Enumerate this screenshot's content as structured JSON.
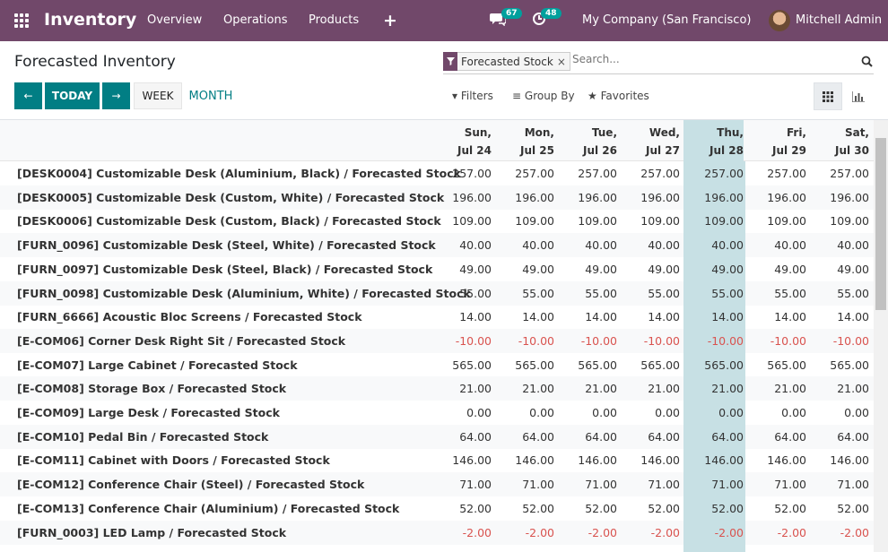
{
  "navbar": {
    "app_title": "Inventory",
    "menu": [
      "Overview",
      "Operations",
      "Products"
    ],
    "plus_label": "+",
    "messages_badge": "67",
    "activities_badge": "48",
    "company": "My Company (San Francisco)",
    "user": "Mitchell Admin",
    "bg_color": "#71486a"
  },
  "control_panel": {
    "breadcrumb": "Forecasted Inventory",
    "search": {
      "facet": "Forecasted Stock",
      "facet_close": "×",
      "placeholder": "Search..."
    },
    "buttons": {
      "prev": "←",
      "today": "TODAY",
      "next": "→",
      "week": "WEEK",
      "month": "MONTH"
    },
    "filters": "Filters",
    "group_by": "Group By",
    "favorites": "Favorites"
  },
  "grid": {
    "columns": [
      {
        "day": "Sun,",
        "date": "Jul 24"
      },
      {
        "day": "Mon,",
        "date": "Jul 25"
      },
      {
        "day": "Tue,",
        "date": "Jul 26"
      },
      {
        "day": "Wed,",
        "date": "Jul 27"
      },
      {
        "day": "Thu,",
        "date": "Jul 28"
      },
      {
        "day": "Fri,",
        "date": "Jul 29"
      },
      {
        "day": "Sat,",
        "date": "Jul 30"
      }
    ],
    "today_index": 4,
    "rows": [
      {
        "label": "[DESK0004] Customizable Desk (Aluminium, Black) /  Forecasted Stock",
        "value": "257.00"
      },
      {
        "label": "[DESK0005] Customizable Desk (Custom, White) /  Forecasted Stock",
        "value": "196.00"
      },
      {
        "label": "[DESK0006] Customizable Desk (Custom, Black) /  Forecasted Stock",
        "value": "109.00"
      },
      {
        "label": "[FURN_0096] Customizable Desk (Steel, White) /  Forecasted Stock",
        "value": "40.00"
      },
      {
        "label": "[FURN_0097] Customizable Desk (Steel, Black) /  Forecasted Stock",
        "value": "49.00"
      },
      {
        "label": "[FURN_0098] Customizable Desk (Aluminium, White) /  Forecasted Stock",
        "value": "55.00"
      },
      {
        "label": "[FURN_6666] Acoustic Bloc Screens /  Forecasted Stock",
        "value": "14.00"
      },
      {
        "label": "[E-COM06] Corner Desk Right Sit /  Forecasted Stock",
        "value": "-10.00"
      },
      {
        "label": "[E-COM07] Large Cabinet /  Forecasted Stock",
        "value": "565.00"
      },
      {
        "label": "[E-COM08] Storage Box /  Forecasted Stock",
        "value": "21.00"
      },
      {
        "label": "[E-COM09] Large Desk /  Forecasted Stock",
        "value": "0.00"
      },
      {
        "label": "[E-COM10] Pedal Bin /  Forecasted Stock",
        "value": "64.00"
      },
      {
        "label": "[E-COM11] Cabinet with Doors /  Forecasted Stock",
        "value": "146.00"
      },
      {
        "label": "[E-COM12] Conference Chair (Steel) /  Forecasted Stock",
        "value": "71.00"
      },
      {
        "label": "[E-COM13] Conference Chair (Aluminium) /  Forecasted Stock",
        "value": "52.00"
      },
      {
        "label": "[FURN_0003] LED Lamp /  Forecasted Stock",
        "value": "-2.00"
      }
    ]
  }
}
